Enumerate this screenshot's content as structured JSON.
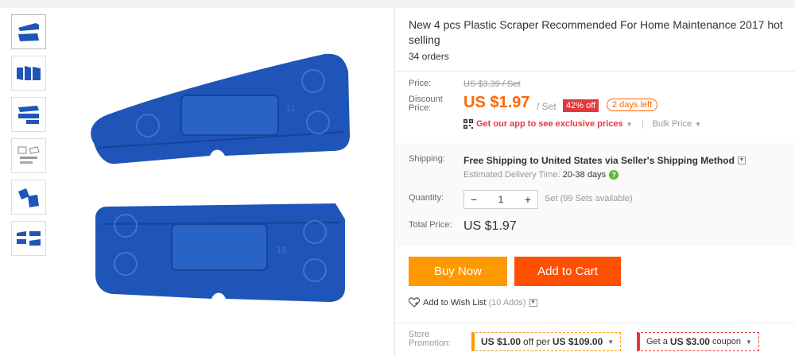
{
  "product": {
    "title": "New 4 pcs Plastic Scraper Recommended For Home Maintenance 2017 hot selling",
    "orders": "34 orders"
  },
  "thumbnails": [
    {
      "icon": "scraper-pair-thumb"
    },
    {
      "icon": "scraper-set-thumb"
    },
    {
      "icon": "scraper-stack-thumb"
    },
    {
      "icon": "diagram-thumb"
    },
    {
      "icon": "scraper-angled-thumb"
    },
    {
      "icon": "scraper-four-thumb"
    }
  ],
  "main_image": {
    "scraper_top_label": "11",
    "scraper_bottom_label": "18"
  },
  "pricing": {
    "price_label": "Price:",
    "old_price": "US $3.39 / Set",
    "discount_label_line1": "Discount",
    "discount_label_line2": "Price:",
    "price": "US $1.97",
    "per_unit": "/ Set",
    "discount_badge": "42% off",
    "days_left": "2 days left",
    "app_promo": "Get our app to see exclusive prices",
    "bulk_price": "Bulk Price"
  },
  "shipping": {
    "label": "Shipping:",
    "method": "Free Shipping to United States via Seller's Shipping Method",
    "delivery_label": "Estimated Delivery Time:",
    "delivery_time": "20-38 days"
  },
  "quantity": {
    "label": "Quantity:",
    "value": "1",
    "minus": "−",
    "plus": "+",
    "available": "Set (99 Sets available)"
  },
  "total": {
    "label": "Total Price:",
    "value": "US $1.97"
  },
  "actions": {
    "buy_now": "Buy Now",
    "add_to_cart": "Add to Cart",
    "wish_list": "Add to Wish List",
    "wish_count": "(10 Adds)"
  },
  "promotion": {
    "label_line1": "Store",
    "label_line2": "Promotion:",
    "promo1_amount": "US $1.00",
    "promo1_mid": "off per",
    "promo1_threshold": "US $109.00",
    "promo2_prefix": "Get a",
    "promo2_amount": "US $3.00",
    "promo2_suffix": "coupon"
  },
  "colors": {
    "accent_orange": "#ff6600",
    "buy_now": "#ff9900",
    "add_to_cart": "#ff4f00",
    "discount_red": "#e4393c",
    "scraper_blue": "#1f55b8"
  }
}
